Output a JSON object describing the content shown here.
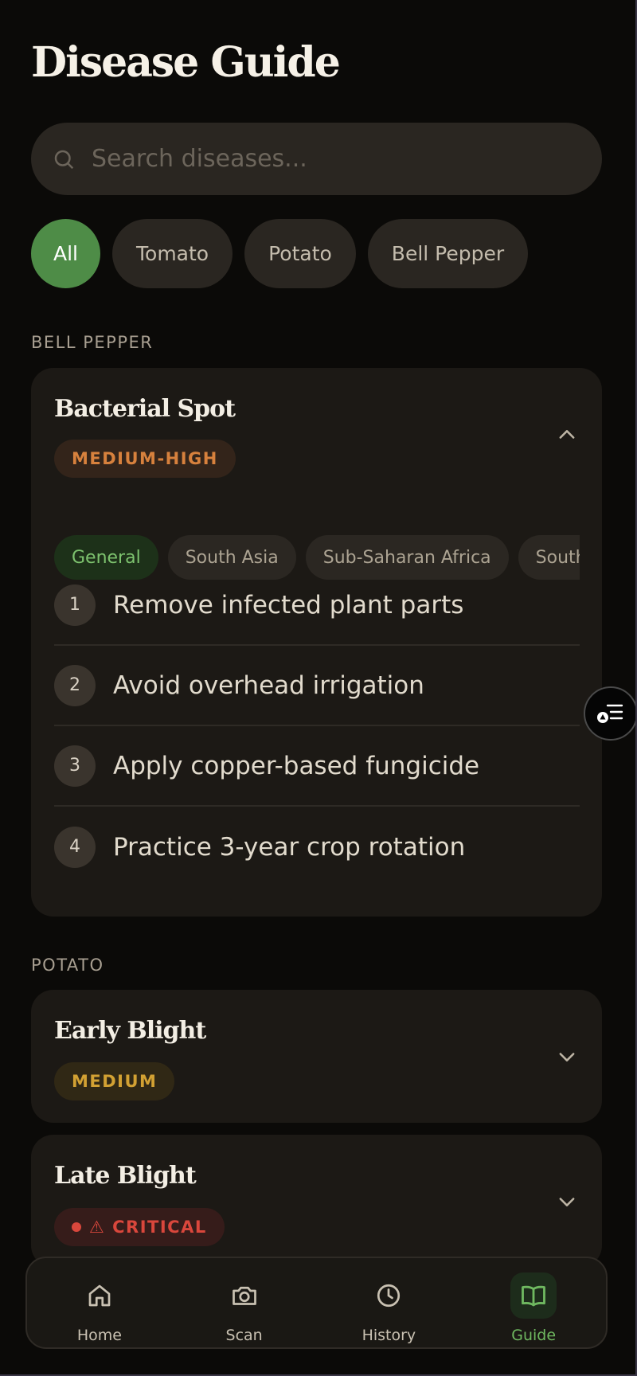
{
  "page": {
    "title": "Disease Guide"
  },
  "search": {
    "placeholder": "Search diseases..."
  },
  "filters": [
    "All",
    "Tomato",
    "Potato",
    "Bell Pepper"
  ],
  "sections": [
    {
      "label": "BELL PEPPER",
      "diseases": [
        {
          "name": "Bacterial Spot",
          "severity": "MEDIUM-HIGH",
          "expanded": true,
          "regions": [
            "General",
            "South Asia",
            "Sub-Saharan Africa",
            "Southe"
          ],
          "steps": [
            {
              "num": "1",
              "text": "Remove infected plant parts"
            },
            {
              "num": "2",
              "text": "Avoid overhead irrigation"
            },
            {
              "num": "3",
              "text": "Apply copper-based fungicide"
            },
            {
              "num": "4",
              "text": "Practice 3-year crop rotation"
            }
          ]
        }
      ]
    },
    {
      "label": "POTATO",
      "diseases": [
        {
          "name": "Early Blight",
          "severity": "MEDIUM",
          "expanded": false
        },
        {
          "name": "Late Blight",
          "severity": "⚠ CRITICAL",
          "expanded": false
        }
      ]
    }
  ],
  "nav": [
    "Home",
    "Scan",
    "History",
    "Guide"
  ],
  "colors": {
    "accent": "#4e8c47",
    "active_tab": "#6fb860",
    "medium_high": "#d7813d",
    "medium": "#d2a133",
    "critical": "#d9473c"
  }
}
